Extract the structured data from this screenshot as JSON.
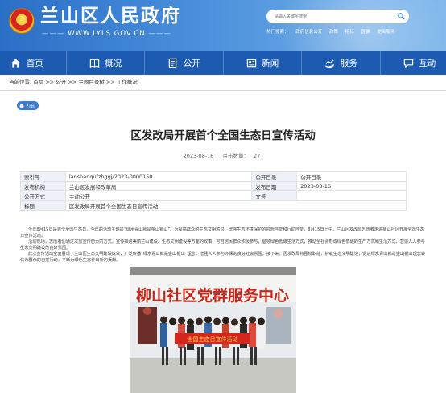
{
  "header": {
    "site_title": "兰山区人民政府",
    "site_url": "WWW.LYLS.GOV.CN",
    "search_placeholder": "请输入关键字搜索",
    "hot_search": [
      "热门搜索：",
      "政府信息公开",
      "政策",
      "招标",
      "医保",
      "便民服务"
    ]
  },
  "nav": {
    "items": [
      {
        "label": "首页",
        "icon": "home-icon"
      },
      {
        "label": "概况",
        "icon": "book-icon"
      },
      {
        "label": "公开",
        "icon": "document-icon"
      },
      {
        "label": "新闻",
        "icon": "newspaper-icon"
      },
      {
        "label": "服务",
        "icon": "service-icon"
      },
      {
        "label": "互动",
        "icon": "chat-icon"
      }
    ]
  },
  "breadcrumb": {
    "prefix": "当前位置:",
    "items": [
      "首页",
      "公开",
      "主题目录树",
      "工作概况"
    ],
    "separator": " >> "
  },
  "print_label": "打印",
  "article": {
    "title": "区发改局开展首个全国生态日宣传活动",
    "date": "2023-08-16",
    "views_label": "点击数量：",
    "views": "27",
    "info": {
      "index_label": "索引号",
      "index_value": "lanshanqufzhggj/2023-0000150",
      "catalog_label": "公开目录",
      "catalog_value": "公开目录",
      "org_label": "发布机构",
      "org_value": "兰山区发展和改革局",
      "pubdate_label": "发布日期",
      "pubdate_value": "2023-08-16",
      "method_label": "公开方式",
      "method_value": "主动公开",
      "docno_label": "文号",
      "docno_value": "",
      "subject_label": "标题",
      "subject_value": "区发改局开展首个全国生态日宣传活动"
    },
    "paragraphs": [
      "今年8月15日是首个全国生态日，今年的活动主题是“绿水青山就是金山银山”。为提高群众的生态文明意识，增强生态环境保护的思想自觉和行动自觉，8月15日上午，兰山区发改局志愿者走进柳山社区开展全国生态日宣传活动。",
      "活动现场，志愿者们通过发放宣传册页的方式，宣传推进美丽兰山建设、生态文明建设等方面的政策，号召居民群众积极参与，倡导绿色低碳生活方式，推动全社会形成绿色低碳的生产方式和生活方式，营造人人参与生态文明建设的良好氛围。",
      "此次宣传活动全面展现了兰山区生态文明建设成效，广泛传播“绿水青山就是金山银山”理念，增强人人参与环保的良好社会氛围。接下来，区发改局将围绕职能，护航生态文明建设，促进绿水青山就是金山银山理念转化为群众的自觉行动，不断为绿色生态作出新的贡献。"
    ],
    "photo_sign": "柳山社区党群服务中心",
    "photo_banner": "全国生态日宣传活动"
  },
  "colors": {
    "nav_bg": "#1d5bb3",
    "header_from": "#2a6fc6",
    "header_to": "#7fb8ec",
    "accent": "#3a7bd5",
    "banner_red": "#d2261e"
  }
}
